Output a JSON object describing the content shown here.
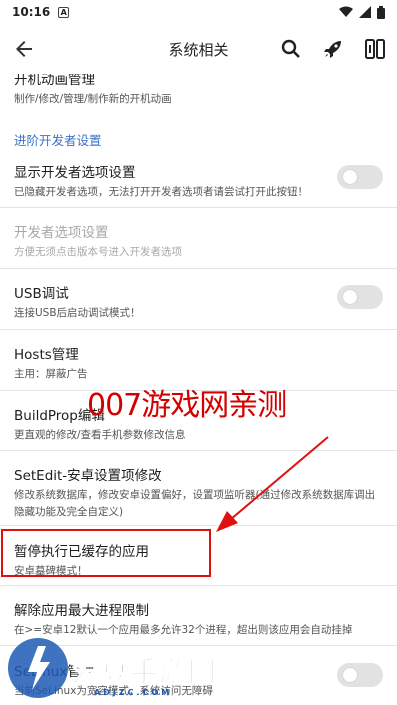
{
  "status_bar": {
    "time": "10:16",
    "notif": "A"
  },
  "app_bar": {
    "title": "系统相关",
    "back_icon": "arrow-back-icon",
    "icons": [
      "search-icon",
      "rocket-icon",
      "layout-toggle-icon"
    ]
  },
  "items": {
    "boot_anim": {
      "title": "开机动画管理",
      "subtitle": "制作/修改/管理/制作新的开机动画"
    },
    "section_dev": "进阶开发者设置",
    "show_dev": {
      "title": "显示开发者选项设置",
      "subtitle": "已隐藏开发者选项，无法打开开发者选项者请尝试打开此按钮！",
      "toggle": "off"
    },
    "dev_options": {
      "title": "开发者选项设置",
      "subtitle": "方便无须点击版本号进入开发者选项",
      "disabled": true
    },
    "usb_debug": {
      "title": "USB调试",
      "subtitle": "连接USB后启动调试模式！",
      "toggle": "off"
    },
    "hosts": {
      "title": "Hosts管理",
      "subtitle": "主用：屏蔽广告"
    },
    "buildprop": {
      "title": "BuildProp编辑",
      "subtitle": "更直观的修改/查看手机参数修改信息"
    },
    "setedit": {
      "title": "SetEdit-安卓设置项修改",
      "subtitle1": "修改系统数据库，修改安卓设置偏好，设置项监听器(通过修改系统数据库调出",
      "subtitle2": "隐藏功能及完全自定义)"
    },
    "suspend_cached": {
      "title": "暂停执行已缓存的应用",
      "subtitle": "安卓墓碑模式！"
    },
    "max_process": {
      "title": "解除应用最大进程限制",
      "subtitle": "在>=安卓12默认一个应用最多允许32个进程，超出则该应用会自动挂掉"
    },
    "selinux": {
      "title": "SeLinux管理",
      "subtitle": "当前SeLinux为宽容模式，系统访问无障碍",
      "toggle": "off"
    }
  },
  "overlays": {
    "watermark": "007游戏网亲测",
    "logo": "爱豆手游网",
    "logo_domain": "ADJZC.COM",
    "highlight_color": "#e01010"
  }
}
